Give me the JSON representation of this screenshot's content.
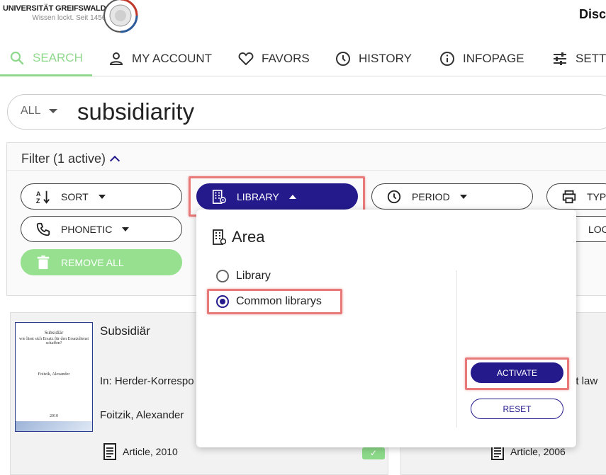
{
  "header": {
    "logo_title": "UNIVERSITÄT GREIFSWALD",
    "logo_subtitle": "Wissen lockt. Seit 1456",
    "app_title": "Disc"
  },
  "nav": {
    "items": [
      {
        "label": "SEARCH",
        "icon": "search-icon",
        "active": true
      },
      {
        "label": "MY ACCOUNT",
        "icon": "person-icon"
      },
      {
        "label": "FAVORS",
        "icon": "heart-icon"
      },
      {
        "label": "HISTORY",
        "icon": "clock-icon"
      },
      {
        "label": "INFOPAGE",
        "icon": "info-icon"
      },
      {
        "label": "SETTI",
        "icon": "sliders-icon"
      }
    ]
  },
  "search": {
    "scope": "ALL",
    "query": "subsidiarity"
  },
  "filter": {
    "header": "Filter (1 active)",
    "buttons": {
      "sort": "SORT",
      "library": "LIBRARY",
      "period": "PERIOD",
      "type": "TYP",
      "phonetic": "PHONETIC",
      "location": "LOC",
      "remove_all": "REMOVE ALL"
    }
  },
  "dropdown": {
    "heading": "Area",
    "options": [
      {
        "label": "Library",
        "checked": false
      },
      {
        "label": "Common librarys",
        "checked": true
      }
    ],
    "activate_label": "ACTIVATE",
    "reset_label": "RESET"
  },
  "results": [
    {
      "title": "Subsidiär",
      "in": "In: Herder-Korrespo",
      "author": "Foitzik, Alexander",
      "type_year": "Article, 2010",
      "check": "✓",
      "cover": {
        "title": "Subsidiär",
        "subtitle": "wie lässt sich Ersatz für den Ersatzdienst schaffen?",
        "author": "Foitzik, Alexander",
        "year": "2010"
      }
    },
    {
      "in_fragment": "et law",
      "type_year": "Article, 2006"
    }
  ],
  "colors": {
    "primary": "#241a8c",
    "accent_green": "#96e08f",
    "highlight": "#e87a7a"
  }
}
